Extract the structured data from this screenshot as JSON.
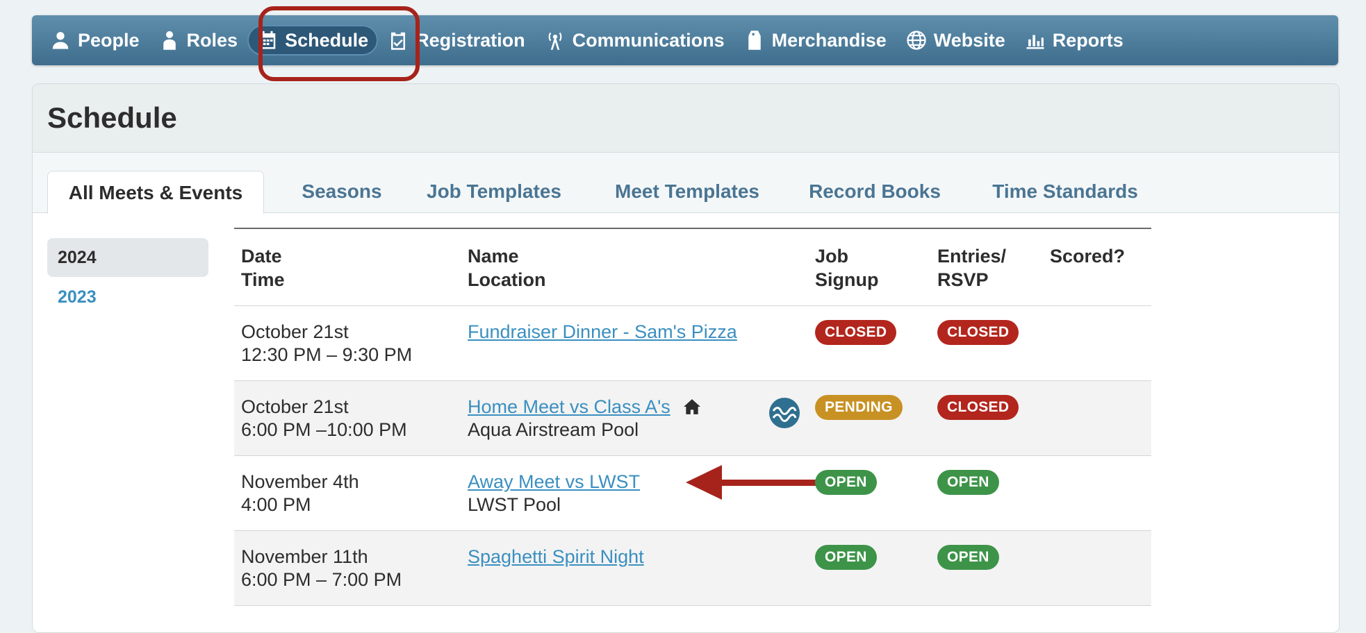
{
  "nav": {
    "items": [
      {
        "label": "People",
        "icon": "person-icon"
      },
      {
        "label": "Roles",
        "icon": "role-icon"
      },
      {
        "label": "Schedule",
        "icon": "calendar-icon",
        "active": true
      },
      {
        "label": "Registration",
        "icon": "clipboard-check-icon"
      },
      {
        "label": "Communications",
        "icon": "antenna-icon"
      },
      {
        "label": "Merchandise",
        "icon": "price-tag-icon"
      },
      {
        "label": "Website",
        "icon": "globe-icon"
      },
      {
        "label": "Reports",
        "icon": "bar-chart-icon"
      }
    ]
  },
  "page": {
    "title": "Schedule"
  },
  "tabs": [
    "All Meets & Events",
    "Seasons",
    "Job Templates",
    "Meet Templates",
    "Record Books",
    "Time Standards"
  ],
  "years": [
    "2024",
    "2023"
  ],
  "table": {
    "headers": {
      "date_line1": "Date",
      "date_line2": "Time",
      "name_line1": "Name",
      "name_line2": "Location",
      "job_line1": "Job",
      "job_line2": "Signup",
      "entries_line1": "Entries/",
      "entries_line2": "RSVP",
      "scored": "Scored?"
    },
    "rows": [
      {
        "date": "October 21st",
        "time": "12:30 PM – 9:30 PM",
        "name": "Fundraiser Dinner - Sam's Pizza",
        "location": "",
        "job_signup": "CLOSED",
        "entries": "CLOSED"
      },
      {
        "date": "October 21st",
        "time": "6:00 PM –10:00 PM",
        "name": "Home Meet vs Class A's",
        "location": "Aqua Airstream Pool",
        "job_signup": "PENDING",
        "entries": "CLOSED",
        "home": true
      },
      {
        "date": "November 4th",
        "time": "4:00 PM",
        "name": "Away Meet vs LWST",
        "location": "LWST Pool",
        "job_signup": "OPEN",
        "entries": "OPEN"
      },
      {
        "date": "November 11th",
        "time": "6:00 PM – 7:00 PM",
        "name": "Spaghetti Spirit Night",
        "location": "",
        "job_signup": "OPEN",
        "entries": "OPEN"
      }
    ]
  },
  "colors": {
    "nav_bg": "#4f7f9f",
    "annotation": "#a6231b",
    "link": "#3a8fc0",
    "closed": "#b3261d",
    "pending": "#c89123",
    "open": "#3d9448"
  }
}
